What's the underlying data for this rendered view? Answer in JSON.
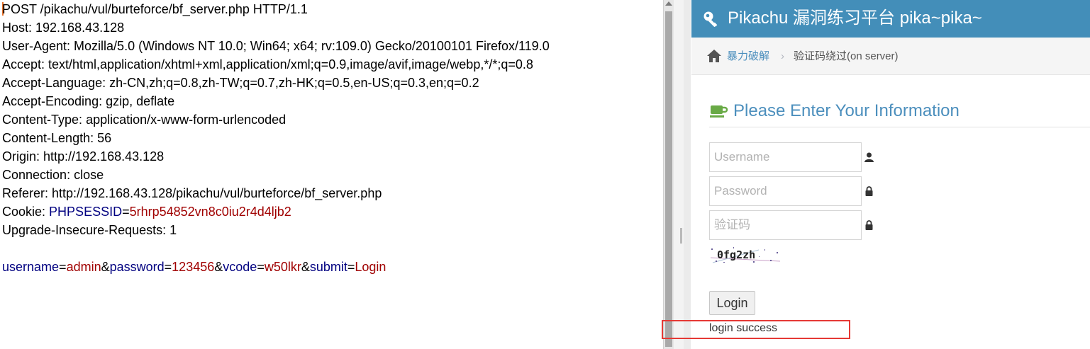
{
  "request": {
    "request_line": "POST /pikachu/vul/burteforce/bf_server.php HTTP/1.1",
    "headers": [
      "Host: 192.168.43.128",
      "User-Agent: Mozilla/5.0 (Windows NT 10.0; Win64; x64; rv:109.0) Gecko/20100101 Firefox/119.0",
      "Accept: text/html,application/xhtml+xml,application/xml;q=0.9,image/avif,image/webp,*/*;q=0.8",
      "Accept-Language: zh-CN,zh;q=0.8,zh-TW;q=0.7,zh-HK;q=0.5,en-US;q=0.3,en;q=0.2",
      "Accept-Encoding: gzip, deflate",
      "Content-Type: application/x-www-form-urlencoded",
      "Content-Length: 56",
      "Origin: http://192.168.43.128",
      "Connection: close",
      "Referer: http://192.168.43.128/pikachu/vul/burteforce/bf_server.php"
    ],
    "cookie": {
      "label": "Cookie: ",
      "name": "PHPSESSID",
      "eq": "=",
      "value": "5rhrp54852vn8c0iu2r4d4ljb2"
    },
    "trailing_header": "Upgrade-Insecure-Requests: 1",
    "body_params": [
      {
        "name": "username",
        "value": "admin"
      },
      {
        "name": "password",
        "value": "123456"
      },
      {
        "name": "vcode",
        "value": "w50lkr"
      },
      {
        "name": "submit",
        "value": "Login"
      }
    ]
  },
  "site": {
    "title": "Pikachu 漏洞练习平台 pika~pika~",
    "breadcrumb": {
      "parent": "暴力破解",
      "separator": "›",
      "current": "验证码绕过(on server)"
    },
    "form": {
      "heading": "Please Enter Your Information",
      "username_placeholder": "Username",
      "password_placeholder": "Password",
      "vcode_placeholder": "验证码",
      "captcha_text": "0fg2zh",
      "login_label": "Login",
      "result": "login success"
    }
  },
  "colors": {
    "header_bg": "#438eb9",
    "link": "#4c8fbd",
    "param_name": "#000080",
    "param_value": "#a00000",
    "highlight": "#e53935"
  }
}
